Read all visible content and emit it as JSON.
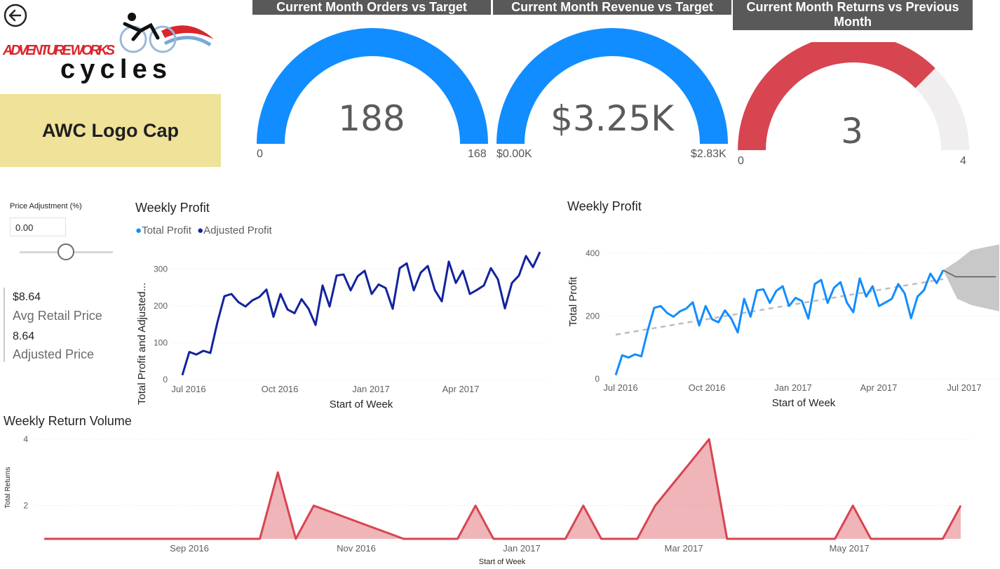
{
  "nav": {
    "back_icon": "back-arrow-icon"
  },
  "logo": {
    "brand_top": "ADVENTURE WORKS",
    "brand_bottom": "cycles"
  },
  "product": {
    "name": "AWC Logo Cap"
  },
  "kpis": [
    {
      "title": "Current Month Orders vs Target",
      "value": "188",
      "min_label": "0",
      "max_label": "168",
      "fill_fraction": 1.0,
      "color": "#118dff"
    },
    {
      "title": "Current Month Revenue vs Target",
      "value": "$3.25K",
      "min_label": "$0.00K",
      "max_label": "$2.83K",
      "fill_fraction": 1.0,
      "color": "#118dff"
    },
    {
      "title": "Current Month Returns vs Previous Month",
      "value": "3",
      "min_label": "0",
      "max_label": "4",
      "fill_fraction": 0.75,
      "color": "#d64550"
    }
  ],
  "slicer": {
    "title": "Price Adjustment (%)",
    "value": "0.00",
    "slider_fraction": 0.5
  },
  "cards": [
    {
      "value": "$8.64",
      "label": "Avg Retail Price"
    },
    {
      "value": "8.64",
      "label": "Adjusted Price"
    }
  ],
  "chart_data": [
    {
      "type": "line",
      "title": "Weekly Profit",
      "xlabel": "Start of Week",
      "ylabel": "Total Profit and Adjusted...",
      "legend": [
        {
          "name": "Total Profit",
          "color": "#118dff"
        },
        {
          "name": "Adjusted Profit",
          "color": "#12239e"
        }
      ],
      "x_ticks": [
        "Jul 2016",
        "Oct 2016",
        "Jan 2017",
        "Apr 2017"
      ],
      "y_ticks": [
        0,
        100,
        200,
        300
      ],
      "ylim": [
        0,
        350
      ],
      "series": [
        {
          "name": "Adjusted Profit",
          "color": "#12239e",
          "values": [
            12,
            75,
            68,
            78,
            72,
            155,
            226,
            232,
            210,
            198,
            215,
            224,
            244,
            170,
            232,
            190,
            180,
            218,
            192,
            148,
            255,
            198,
            282,
            285,
            242,
            280,
            295,
            232,
            258,
            248,
            192,
            302,
            315,
            242,
            290,
            308,
            243,
            212,
            320,
            262,
            295,
            232,
            243,
            255,
            302,
            272,
            193,
            262,
            282,
            335,
            305,
            346
          ]
        }
      ]
    },
    {
      "type": "line",
      "title": "Weekly Profit",
      "xlabel": "Start of Week",
      "ylabel": "Total Profit",
      "x_ticks": [
        "Jul 2016",
        "Oct 2016",
        "Jan 2017",
        "Apr 2017",
        "Jul 2017"
      ],
      "y_ticks": [
        0,
        200,
        400
      ],
      "ylim": [
        0,
        420
      ],
      "trendline": true,
      "forecast": true,
      "series": [
        {
          "name": "Total Profit",
          "color": "#118dff",
          "values": [
            12,
            75,
            68,
            78,
            72,
            155,
            226,
            232,
            210,
            198,
            215,
            224,
            244,
            170,
            232,
            190,
            180,
            218,
            192,
            148,
            255,
            198,
            282,
            285,
            242,
            280,
            295,
            232,
            258,
            248,
            192,
            302,
            315,
            242,
            290,
            308,
            243,
            212,
            320,
            262,
            295,
            232,
            243,
            255,
            302,
            272,
            193,
            262,
            282,
            335,
            305,
            346
          ]
        }
      ]
    },
    {
      "type": "area",
      "title": "Weekly Return Volume",
      "xlabel": "Start of Week",
      "ylabel": "Total Returns",
      "x_ticks": [
        "Sep 2016",
        "Nov 2016",
        "Jan 2017",
        "Mar 2017",
        "May 2017"
      ],
      "y_ticks": [
        2,
        4
      ],
      "ylim": [
        1,
        4
      ],
      "series": [
        {
          "name": "Total Returns",
          "color": "#d64550",
          "values": [
            1,
            1,
            1,
            1,
            1,
            1,
            1,
            1,
            1,
            1,
            1,
            1,
            1,
            3,
            1,
            2,
            1.8,
            1.6,
            1.4,
            1.2,
            1,
            1,
            1,
            1,
            2,
            1,
            1,
            1,
            1,
            1,
            2,
            1,
            1,
            1,
            2,
            2.67,
            3.33,
            4,
            1,
            1,
            1,
            1,
            1,
            1,
            1,
            2,
            1,
            1,
            1,
            1,
            1,
            2
          ]
        }
      ]
    }
  ]
}
